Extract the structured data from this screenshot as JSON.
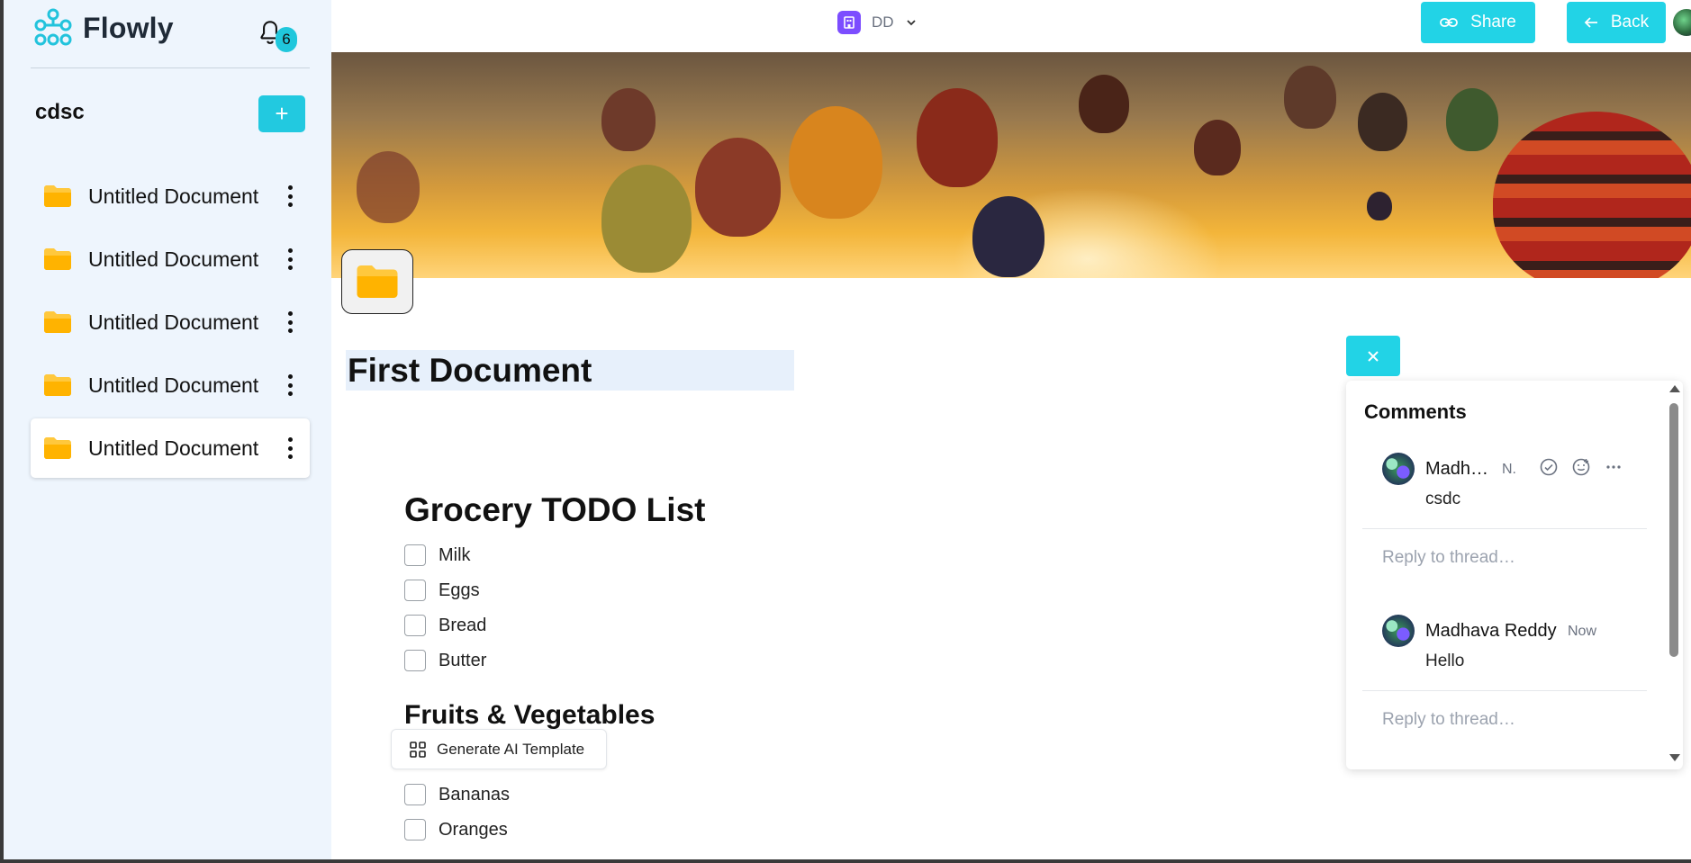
{
  "app": {
    "name": "Flowly",
    "notification_count": "6"
  },
  "sidebar": {
    "workspace_name": "cdsc",
    "add_icon": "plus-icon",
    "items": [
      {
        "label": "Untitled Document",
        "icon": "folder-icon",
        "active": false
      },
      {
        "label": "Untitled Document",
        "icon": "folder-icon",
        "active": false
      },
      {
        "label": "Untitled Document",
        "icon": "folder-icon",
        "active": false
      },
      {
        "label": "Untitled Document",
        "icon": "folder-icon",
        "active": false
      },
      {
        "label": "Untitled Document",
        "icon": "folder-icon",
        "active": true
      }
    ]
  },
  "topbar": {
    "workspace_label": "DD",
    "share_label": "Share",
    "back_label": "Back"
  },
  "document": {
    "title": "First Document",
    "heading_1": "Grocery TODO List",
    "todos_1": [
      "Milk",
      "Eggs",
      "Bread",
      "Butter"
    ],
    "heading_2": "Fruits & Vegetables",
    "todos_2": [
      "Bananas",
      "Oranges"
    ],
    "generate_ai_label": "Generate AI Template"
  },
  "comments": {
    "title": "Comments",
    "threads": [
      {
        "author": "Madh…",
        "time": "N.",
        "body": "csdc",
        "reply_placeholder": "Reply to thread…"
      },
      {
        "author": "Madhava Reddy",
        "time": "Now",
        "body": "Hello",
        "reply_placeholder": "Reply to thread…"
      }
    ]
  },
  "colors": {
    "accent": "#22d3e6",
    "sidebar_bg": "#eef5fd",
    "title_highlight": "#e7f0fb"
  }
}
